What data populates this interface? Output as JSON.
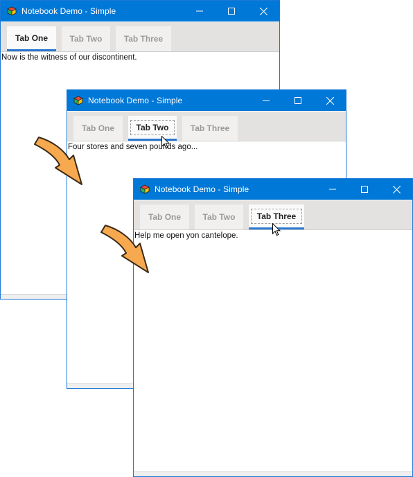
{
  "windows": [
    {
      "title": "Notebook Demo - Simple",
      "tabs": [
        "Tab One",
        "Tab Two",
        "Tab Three"
      ],
      "active_tab": "Tab One",
      "content_text": "Now is the witness of our discontinent."
    },
    {
      "title": "Notebook Demo - Simple",
      "tabs": [
        "Tab One",
        "Tab Two",
        "Tab Three"
      ],
      "active_tab": "Tab Two",
      "content_text": "Four stores and seven pounds ago..."
    },
    {
      "title": "Notebook Demo - Simple",
      "tabs": [
        "Tab One",
        "Tab Two",
        "Tab Three"
      ],
      "active_tab": "Tab Three",
      "content_text": "Help me open yon cantelope."
    }
  ],
  "colors": {
    "titlebar": "#0078d7",
    "tab_underline": "#2a78d0",
    "arrow_fill": "#f7a94f"
  },
  "icons": [
    "app-cube-icon",
    "minimize-icon",
    "maximize-icon",
    "close-icon",
    "mouse-cursor-icon",
    "curved-arrow-icon"
  ]
}
